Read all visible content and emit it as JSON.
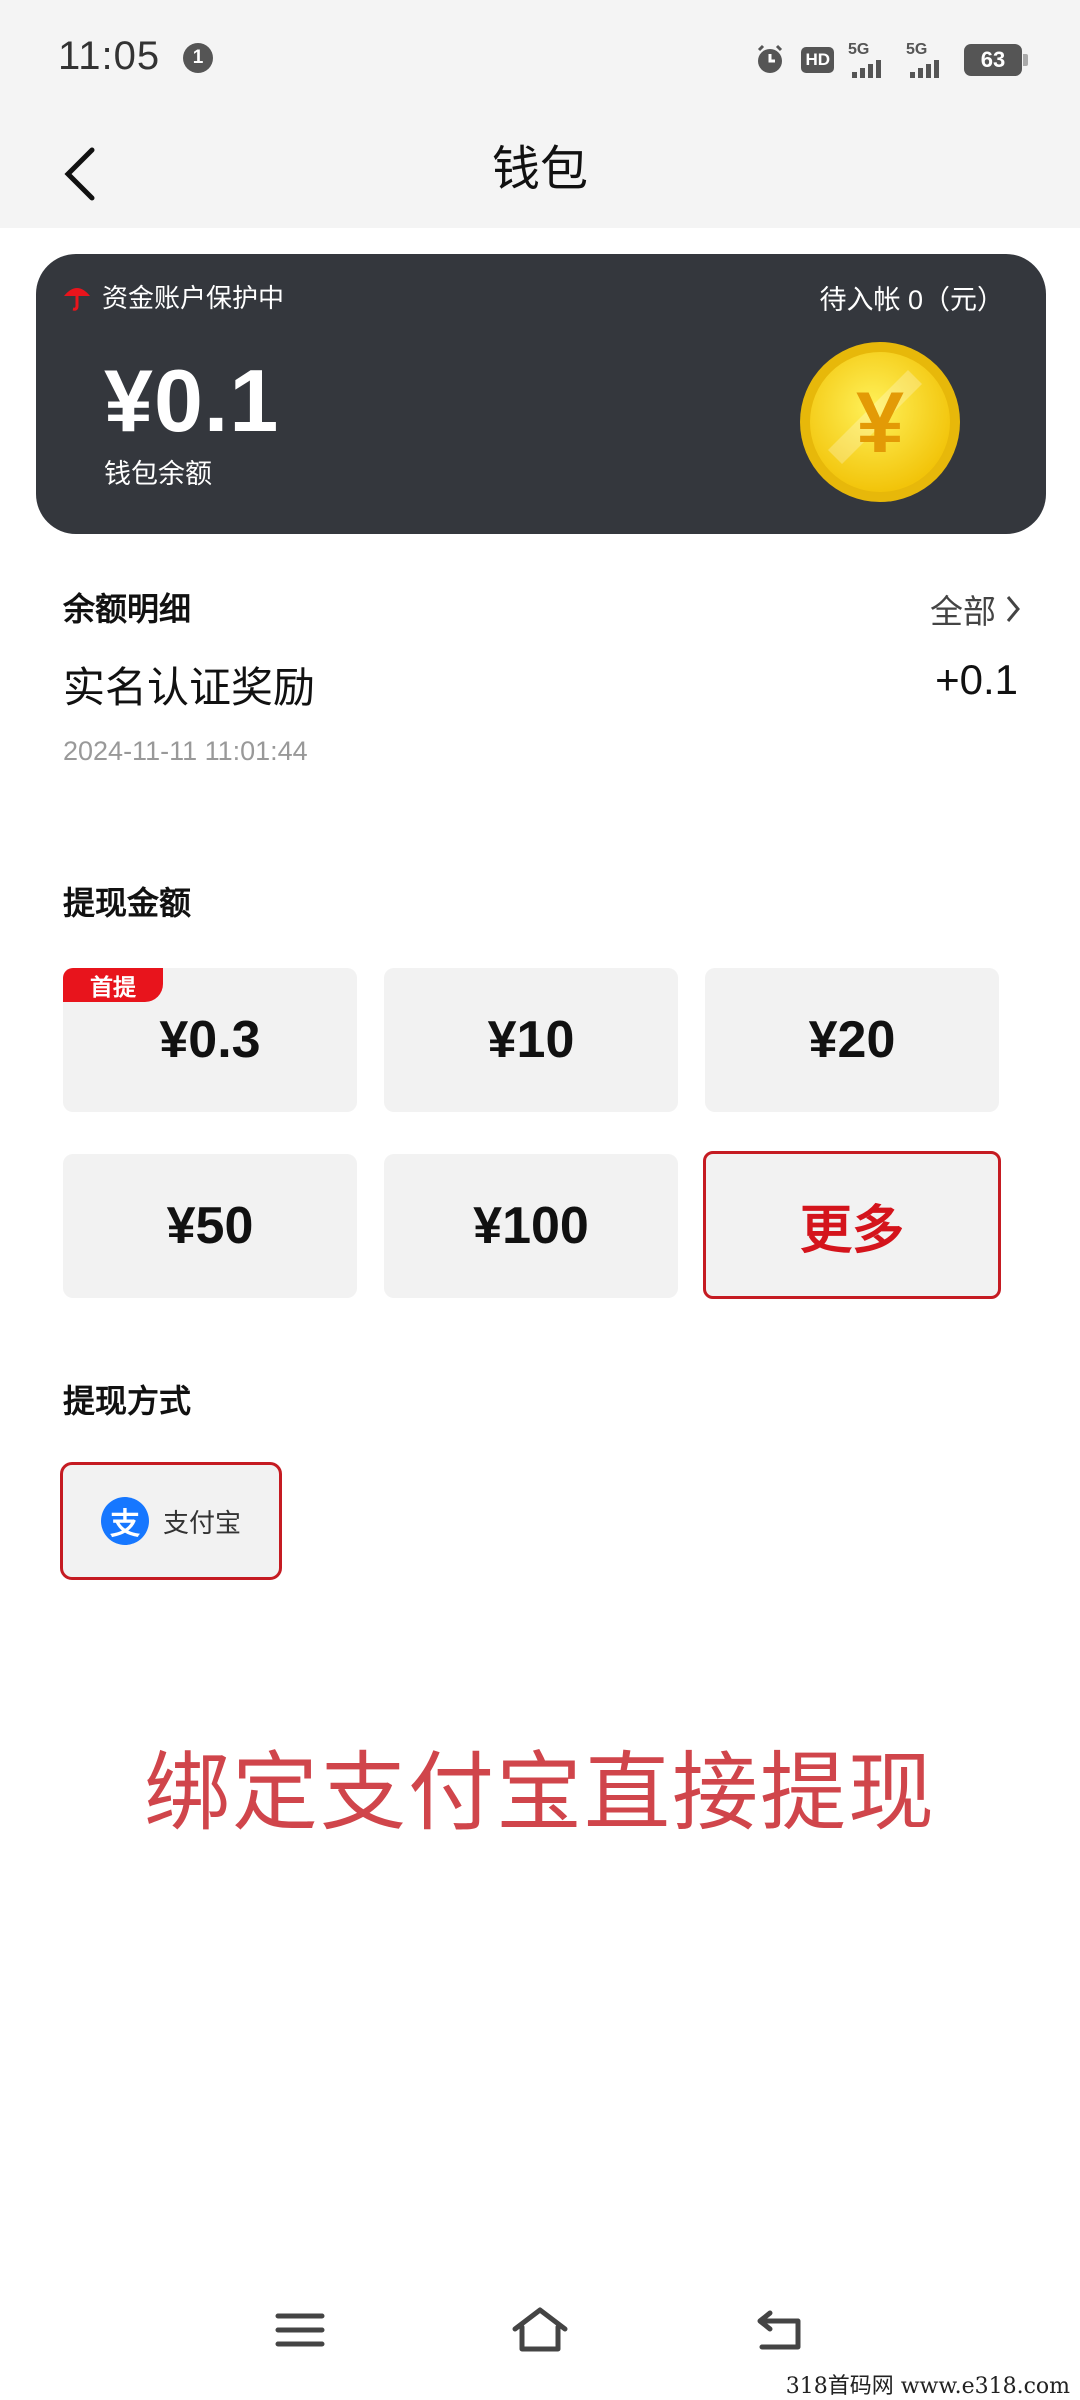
{
  "status_bar": {
    "time": "11:05",
    "notification_count": "1",
    "battery": "63",
    "signal_1": "5G",
    "signal_2": "5G",
    "hd_label": "HD"
  },
  "header": {
    "title": "钱包"
  },
  "wallet_card": {
    "protect_text": "资金账户保护中",
    "pending_text": "待入帐 0（元）",
    "balance": "¥0.1",
    "balance_label": "钱包余额",
    "coin_symbol": "¥",
    "accent_color": "#34373d",
    "coin_color": "#f5d315"
  },
  "balance_detail": {
    "title": "余额明细",
    "all_label": "全部",
    "items": [
      {
        "name": "实名认证奖励",
        "value": "+0.1",
        "time": "2024-11-11 11:01:44"
      }
    ]
  },
  "withdraw": {
    "title": "提现金额",
    "first_badge": "首提",
    "amounts": [
      "¥0.3",
      "¥10",
      "¥20",
      "¥50",
      "¥100"
    ],
    "more_label": "更多",
    "highlight_color": "#d4141c"
  },
  "method": {
    "title": "提现方式",
    "alipay_label": "支付宝",
    "alipay_logo_char": "支"
  },
  "promo_text": "绑定支付宝直接提现",
  "watermark": "318首码网  www.e318.com"
}
